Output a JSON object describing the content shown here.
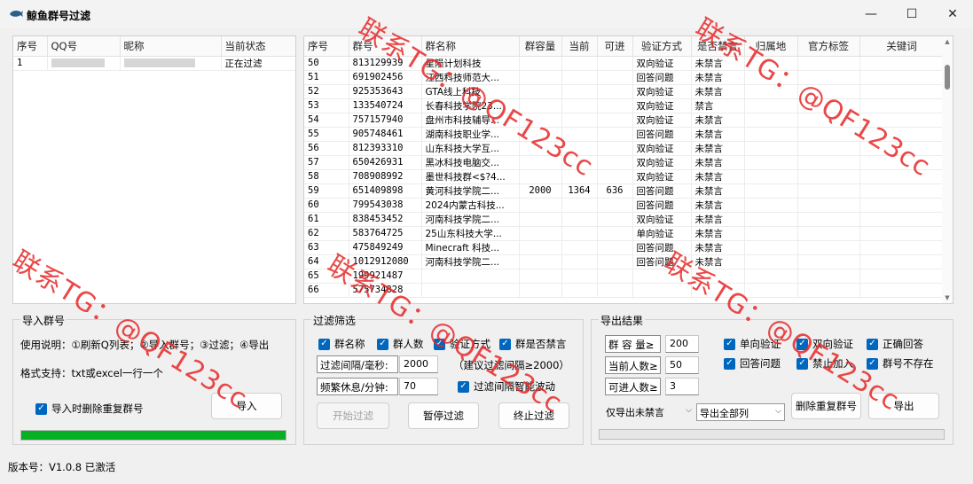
{
  "window": {
    "title": "鲸鱼群号过滤",
    "minimize": "—",
    "maximize": "☐",
    "close": "✕"
  },
  "left_table": {
    "headers": [
      "序号",
      "QQ号",
      "昵称",
      "当前状态"
    ],
    "rows": [
      [
        "1",
        "",
        "",
        "正在过滤"
      ]
    ]
  },
  "group_table": {
    "headers": [
      "序号",
      "群号",
      "群名称",
      "群容量",
      "当前",
      "可进",
      "验证方式",
      "是否禁言",
      "归属地",
      "官方标签",
      "关键词"
    ],
    "rows": [
      [
        "50",
        "813129939",
        "星陨计划科技",
        "",
        "",
        "",
        "双向验证",
        "未禁言"
      ],
      [
        "51",
        "691902456",
        "江西科技师范大...",
        "",
        "",
        "",
        "回答问题",
        "未禁言"
      ],
      [
        "52",
        "925353643",
        "GTA线上科技",
        "",
        "",
        "",
        "双向验证",
        "未禁言"
      ],
      [
        "53",
        "133540724",
        "长春科技学院23...",
        "",
        "",
        "",
        "双向验证",
        "禁言"
      ],
      [
        "54",
        "757157940",
        "盘州市科技辅导...",
        "",
        "",
        "",
        "双向验证",
        "未禁言"
      ],
      [
        "55",
        "905748461",
        "湖南科技职业学...",
        "",
        "",
        "",
        "回答问题",
        "未禁言"
      ],
      [
        "56",
        "812393310",
        "山东科技大学互...",
        "",
        "",
        "",
        "双向验证",
        "未禁言"
      ],
      [
        "57",
        "650426931",
        "黑冰科技电脑交...",
        "",
        "",
        "",
        "双向验证",
        "未禁言"
      ],
      [
        "58",
        "708908992",
        "墨世科技群<$?4...",
        "",
        "",
        "",
        "双向验证",
        "未禁言"
      ],
      [
        "59",
        "651409898",
        "黄河科技学院二...",
        "2000",
        "1364",
        "636",
        "回答问题",
        "未禁言"
      ],
      [
        "60",
        "799543038",
        "2024内蒙古科技...",
        "",
        "",
        "",
        "回答问题",
        "未禁言"
      ],
      [
        "61",
        "838453452",
        "河南科技学院二...",
        "",
        "",
        "",
        "双向验证",
        "未禁言"
      ],
      [
        "62",
        "583764725",
        "25山东科技大学...",
        "",
        "",
        "",
        "单向验证",
        "未禁言"
      ],
      [
        "63",
        "475849249",
        "Minecraft 科技...",
        "",
        "",
        "",
        "回答问题",
        "未禁言"
      ],
      [
        "64",
        "1012912080",
        "河南科技学院二...",
        "",
        "",
        "",
        "回答问题",
        "未禁言"
      ],
      [
        "65",
        "199921487",
        "",
        "",
        "",
        "",
        "",
        ""
      ],
      [
        "66",
        "575734828",
        "",
        "",
        "",
        "",
        "",
        ""
      ]
    ]
  },
  "import_group": {
    "title": "导入群号",
    "usage": "使用说明：①刷新Q列表；②导入群号；③过滤；④导出",
    "format": "格式支持：txt或excel一行一个",
    "dedupe_label": "导入时删除重复群号",
    "import_button": "导入",
    "progress": 1.0
  },
  "filter_group": {
    "title": "过滤筛选",
    "checks": [
      "群名称",
      "群人数",
      "验证方式",
      "群是否禁言"
    ],
    "interval_label": "过滤间隔/毫秒:",
    "interval_value": "2000",
    "interval_hint": "（建议过滤间隔≥2000）",
    "rest_label": "频繁休息/分钟:",
    "rest_value": "70",
    "smart_label": "过滤间隔智能波动",
    "start_button": "开始过滤",
    "pause_button": "暂停过滤",
    "stop_button": "终止过滤"
  },
  "export_group": {
    "title": "导出结果",
    "capacity_label": "群 容 量≥",
    "capacity_value": "200",
    "current_label": "当前人数≥",
    "current_value": "50",
    "joinable_label": "可进人数≥",
    "joinable_value": "3",
    "checks": [
      "单向验证",
      "双向验证",
      "正确回答",
      "回答问题",
      "禁止加入",
      "群号不存在"
    ],
    "select_mute": "仅导出未禁言",
    "select_range": "导出全部列",
    "dedupe_button": "删除重复群号",
    "export_button": "导出",
    "progress": 0
  },
  "status": {
    "version": "版本号：V1.0.8 已激活"
  },
  "watermark": "联系TG：@QF123cc"
}
